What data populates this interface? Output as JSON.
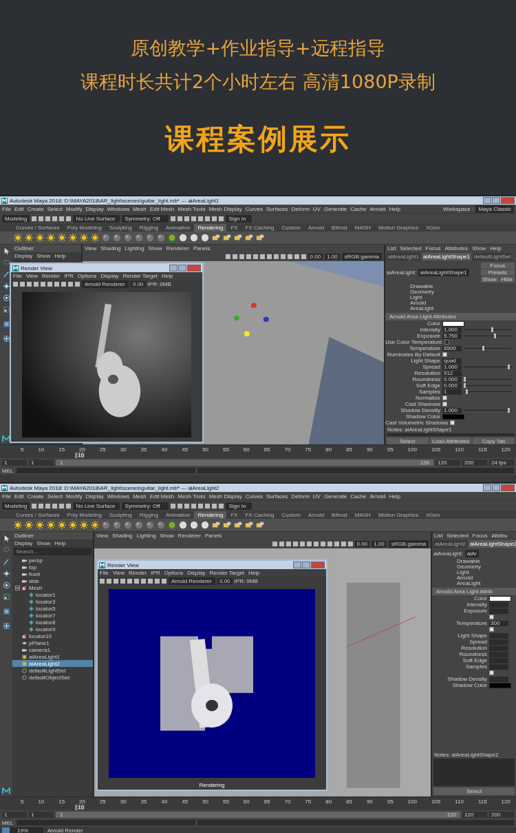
{
  "banner": {
    "lines": [
      "原创教学+作业指导+远程指导",
      "课程时长共计2个小时左右 高清1080P录制"
    ],
    "heading": "课程案例展示"
  },
  "screens": [
    {
      "title": "Autodesk Maya 2018: D:\\MAYA2018\\AR_light\\scenes\\guitar_light.mb* --- aiAreaLight1",
      "workspace_label": "Workspace :",
      "workspace": "Maya Classic",
      "menus": [
        "File",
        "Edit",
        "Create",
        "Select",
        "Modify",
        "Display",
        "Windows",
        "Mesh",
        "Edit Mesh",
        "Mesh Tools",
        "Mesh Display",
        "Curves",
        "Surfaces",
        "Deform",
        "UV",
        "Generate",
        "Cache",
        "Arnold",
        "Help"
      ],
      "mode": "Modeling",
      "live_surface": "No Live Surface",
      "symmetry": "Symmetry: Off",
      "sign_in": "Sign In",
      "shelf_tabs": [
        {
          "label": "Curves / Surfaces",
          "selected": false
        },
        {
          "label": "Poly Modeling",
          "selected": false
        },
        {
          "label": "Sculpting",
          "selected": false
        },
        {
          "label": "Rigging",
          "selected": false
        },
        {
          "label": "Animation",
          "selected": false
        },
        {
          "label": "Rendering",
          "selected": true
        },
        {
          "label": "FX",
          "selected": false
        },
        {
          "label": "FX Caching",
          "selected": false
        },
        {
          "label": "Custom",
          "selected": false
        },
        {
          "label": "Arnold",
          "selected": false
        },
        {
          "label": "Bifrost",
          "selected": false
        },
        {
          "label": "MASH",
          "selected": false
        },
        {
          "label": "Motion Graphics",
          "selected": false
        },
        {
          "label": "XGen",
          "selected": false
        }
      ],
      "outliner": {
        "title": "Outliner",
        "menus": [
          "Display",
          "Show",
          "Help"
        ]
      },
      "viewport": {
        "menus": [
          "View",
          "Shading",
          "Lighting",
          "Show",
          "Renderer",
          "Panels"
        ],
        "fields": [
          "0.00",
          "1.00"
        ],
        "color_space": "sRGB gamma"
      },
      "render_view": {
        "title": "Render View",
        "menus": [
          "File",
          "View",
          "Render",
          "IPR",
          "Options",
          "Display",
          "Render Target",
          "Help"
        ],
        "renderer": "Arnold Renderer",
        "exposure": "0.00",
        "ipr": "IPR: 0MB"
      },
      "attribute_editor": {
        "menus": [
          "List",
          "Selected",
          "Focus",
          "Attributes",
          "Show",
          "Help"
        ],
        "node_tabs": [
          {
            "label": "aiAreaLight1",
            "selected": false
          },
          {
            "label": "aiAreaLightShape1",
            "selected": true
          },
          {
            "label": "defaultLightSet",
            "selected": false
          }
        ],
        "node_label": "aiAreaLight:",
        "node_name": "aiAreaLightShape1",
        "buttons": [
          "Focus",
          "Presets",
          "Show",
          "Hide"
        ],
        "node_types": [
          "Drawable",
          "Geometry",
          "Light",
          "Arnold",
          "AreaLight"
        ],
        "section": "Arnold Area Light Attributes",
        "rows": [
          {
            "kind": "color",
            "label": "Color",
            "color": "#ffffff"
          },
          {
            "kind": "slider",
            "label": "Intensity",
            "value": "1.000",
            "level": 0.6
          },
          {
            "kind": "slider",
            "label": "Exposure",
            "value": "5.750",
            "level": 0.65
          },
          {
            "kind": "check",
            "label": "Use Color Temperature",
            "checked": false
          },
          {
            "kind": "slider",
            "label": "Temperature",
            "value": "6500",
            "level": 0.4
          },
          {
            "kind": "check",
            "label": "Illuminates By Default",
            "checked": true
          },
          {
            "kind": "field",
            "label": "Light Shape",
            "value": "quad"
          },
          {
            "kind": "slider",
            "label": "Spread",
            "value": "1.000",
            "level": 0.95
          },
          {
            "kind": "field",
            "label": "Resolution",
            "value": "512"
          },
          {
            "kind": "slider",
            "label": "Roundness",
            "value": "0.000",
            "level": 0.0
          },
          {
            "kind": "slider",
            "label": "Soft Edge",
            "value": "0.000",
            "level": 0.0
          },
          {
            "kind": "slider",
            "label": "Samples",
            "value": "1",
            "level": 0.05
          },
          {
            "kind": "check",
            "label": "Normalize",
            "checked": true
          },
          {
            "kind": "check",
            "label": "Cast Shadows",
            "checked": true
          },
          {
            "kind": "slider",
            "label": "Shadow Density",
            "value": "1.000",
            "level": 0.95
          },
          {
            "kind": "color",
            "label": "Shadow Color",
            "color": "#000000"
          },
          {
            "kind": "check",
            "label": "Cast Volumetric Shadows",
            "checked": true
          }
        ],
        "notes": "Notes:  aiAreaLightShape1",
        "bottom_buttons": [
          "Select",
          "Load Attributes",
          "Copy Tab"
        ]
      },
      "timeline": {
        "ticks": [
          "5",
          "10",
          "15",
          "20",
          "25",
          "30",
          "35",
          "40",
          "45",
          "50",
          "55",
          "60",
          "65",
          "70",
          "75",
          "80",
          "85",
          "90",
          "95",
          "100",
          "105",
          "110",
          "115",
          "120"
        ],
        "current": "16",
        "level": 0.126,
        "range_before": [
          "1",
          "1"
        ],
        "range_slider": {
          "start": "1",
          "end": "120",
          "level": 1
        },
        "range_after": [
          "120",
          "200"
        ],
        "fps": "24 fps",
        "mel": "MEL"
      }
    },
    {
      "title": "Autodesk Maya 2018: D:\\MAYA2018\\AR_light\\scenes\\guitar_light.mb* --- aiAreaLight2",
      "menus": [
        "File",
        "Edit",
        "Create",
        "Select",
        "Modify",
        "Display",
        "Windows",
        "Mesh",
        "Edit Mesh",
        "Mesh Tools",
        "Mesh Display",
        "Curves",
        "Surfaces",
        "Deform",
        "UV",
        "Generate",
        "Cache",
        "Arnold",
        "Help"
      ],
      "mode": "Modeling",
      "live_surface": "No Live Surface",
      "symmetry": "Symmetry: Off",
      "sign_in": "Sign In",
      "shelf_tabs": [
        {
          "label": "Curves / Surfaces",
          "selected": false
        },
        {
          "label": "Poly Modeling",
          "selected": false
        },
        {
          "label": "Sculpting",
          "selected": false
        },
        {
          "label": "Rigging",
          "selected": false
        },
        {
          "label": "Animation",
          "selected": false
        },
        {
          "label": "Rendering",
          "selected": true
        },
        {
          "label": "FX",
          "selected": false
        },
        {
          "label": "FX Caching",
          "selected": false
        },
        {
          "label": "Custom",
          "selected": false
        },
        {
          "label": "Arnold",
          "selected": false
        },
        {
          "label": "Bifrost",
          "selected": false
        },
        {
          "label": "MASH",
          "selected": false
        },
        {
          "label": "Motion Graphics",
          "selected": false
        },
        {
          "label": "XGen",
          "selected": false
        }
      ],
      "outliner": {
        "title": "Outliner",
        "menus": [
          "Display",
          "Show",
          "Help"
        ],
        "search": "Search...",
        "items": [
          {
            "kind": "camera",
            "label": "persp",
            "selected": false
          },
          {
            "kind": "camera",
            "label": "top",
            "selected": false
          },
          {
            "kind": "camera",
            "label": "front",
            "selected": false
          },
          {
            "kind": "camera",
            "label": "side",
            "selected": false
          },
          {
            "kind": "group",
            "label": "Mesh",
            "selected": false,
            "expanded": true,
            "children": [
              {
                "kind": "locator",
                "label": "locator1",
                "selected": false
              },
              {
                "kind": "locator",
                "label": "locator3",
                "selected": false
              },
              {
                "kind": "locator",
                "label": "locator5",
                "selected": false
              },
              {
                "kind": "locator",
                "label": "locator7",
                "selected": false
              },
              {
                "kind": "locator",
                "label": "locator8",
                "selected": false
              },
              {
                "kind": "locator",
                "label": "locator9",
                "selected": false
              }
            ]
          },
          {
            "kind": "group",
            "label": "locator10",
            "selected": false
          },
          {
            "kind": "mesh",
            "label": "pPlane1",
            "selected": false
          },
          {
            "kind": "camera",
            "label": "camera1",
            "selected": false
          },
          {
            "kind": "light",
            "label": "aiAreaLight1",
            "selected": false
          },
          {
            "kind": "light",
            "label": "aiAreaLight2",
            "selected": true
          },
          {
            "kind": "set",
            "label": "defaultLightSet",
            "selected": false
          },
          {
            "kind": "set",
            "label": "defaultObjectSet",
            "selected": false
          }
        ]
      },
      "viewport": {
        "menus": [
          "View",
          "Shading",
          "Lighting",
          "Show",
          "Renderer",
          "Panels"
        ],
        "fields": [
          "0.00",
          "1.00"
        ],
        "color_space": "sRGB gamma"
      },
      "render_view": {
        "title": "Render View",
        "menus": [
          "File",
          "View",
          "Render",
          "IPR",
          "Options",
          "Display",
          "Render Target",
          "Help"
        ],
        "renderer": "Arnold Renderer",
        "exposure": "0.00",
        "ipr": "IPR: 0MB",
        "status": "Rendering"
      },
      "attribute_editor": {
        "menus": [
          "List",
          "Selected",
          "Focus",
          "Attribu"
        ],
        "node_tabs": [
          {
            "label": "aiAreaLight2",
            "selected": false
          },
          {
            "label": "aiAreaLightShape2",
            "selected": true
          }
        ],
        "node_label": "aiAreaLight:",
        "node_name": "aiAr",
        "node_types": [
          "Drawable",
          "Geometry",
          "Light",
          "Arnold",
          "AreaLight"
        ],
        "section": "Arnold Area Light Attrib",
        "rows": [
          {
            "kind": "color",
            "label": "Color",
            "color": "#ffffff"
          },
          {
            "kind": "field",
            "label": "Intensity"
          },
          {
            "kind": "field",
            "label": "Exposure"
          },
          {
            "kind": "check",
            "checked": true
          },
          {
            "kind": "field",
            "label": "Temperature",
            "value": "300"
          },
          {
            "kind": "check",
            "checked": true
          },
          {
            "kind": "field",
            "label": "Light Shape"
          },
          {
            "kind": "field",
            "label": "Spread"
          },
          {
            "kind": "field",
            "label": "Resolution"
          },
          {
            "kind": "field",
            "label": "Roundness"
          },
          {
            "kind": "field",
            "label": "Soft Edge"
          },
          {
            "kind": "field",
            "label": "Samples"
          },
          {
            "kind": "check",
            "checked": true
          },
          {
            "kind": "field",
            "label": "Shadow Density"
          },
          {
            "kind": "color",
            "label": "Shadow Color",
            "color": "#000000"
          }
        ],
        "notes": "Notes:  aiAreaLightShape2",
        "bottom_buttons": [
          "Select"
        ]
      },
      "timeline": {
        "ticks": [
          "5",
          "10",
          "15",
          "20",
          "25",
          "30",
          "35",
          "40",
          "45",
          "50",
          "55",
          "60",
          "65",
          "70",
          "75",
          "80",
          "85",
          "90",
          "95",
          "100",
          "105",
          "110",
          "115",
          "120"
        ],
        "current": "16",
        "level": 0.126,
        "range_before": [
          "1",
          "1"
        ],
        "range_slider": {
          "start": "1",
          "end": "120",
          "level": 1
        },
        "range_after": [
          "120",
          "200"
        ],
        "mel": "MEL",
        "progress": {
          "label": "19%",
          "level": 0.19,
          "task": "Arnold Render"
        }
      }
    }
  ]
}
